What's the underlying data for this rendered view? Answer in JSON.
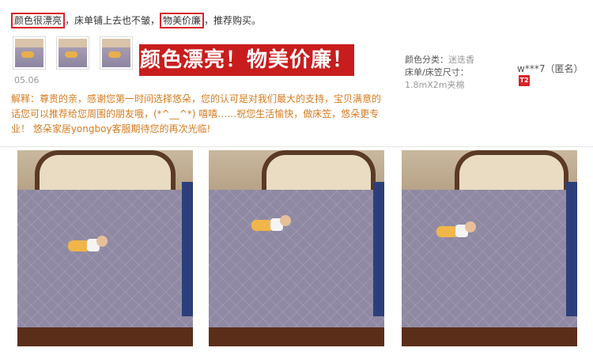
{
  "review": {
    "highlight1": "颜色很漂亮",
    "text_mid": "，床单铺上去也不皱，",
    "highlight2": "物美价廉",
    "text_end": "，推荐购买。",
    "date": "05.06",
    "banner": "颜色漂亮！物美价廉！",
    "reply_prefix": "解释：",
    "reply_text": "尊贵的亲，感谢您第一时间选择悠朵，您的认可是对我们最大的支持，宝贝满意的话您可以推荐给您周围的朋友哦，(*^__^*) 嘻嘻……祝您生活愉快，做床笠，悠朵更专业！ 悠朵家居yongboy客服期待您的再次光临!"
  },
  "spec": {
    "color_label": "颜色分类：",
    "color_value": "迷迭香",
    "size_label": "床单/床笠尺寸：",
    "size_value": "1.8mX2m夹棉"
  },
  "user": {
    "name": "w***7（匿名）",
    "badge": "T2"
  },
  "icons": {
    "badge_color": "#d8232a",
    "banner_color": "#c91d1d",
    "reply_color": "#d57a1f"
  }
}
